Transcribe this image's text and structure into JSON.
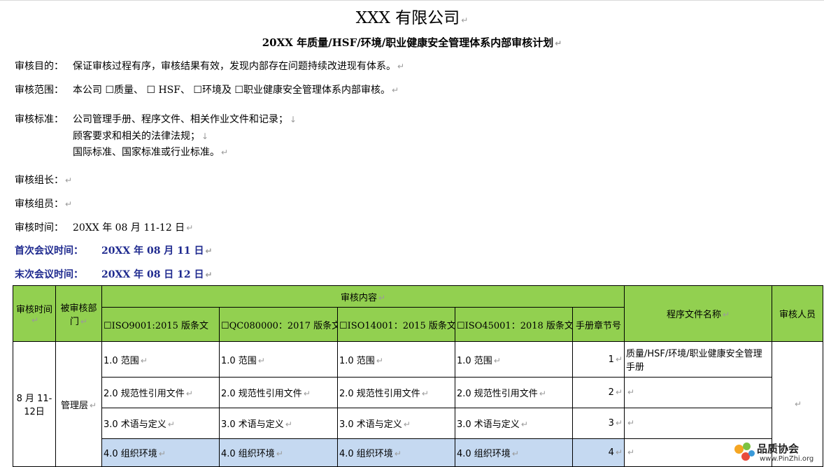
{
  "header": {
    "company": "XXX 有限公司",
    "plan_title": "20XX 年质量/HSF/环境/职业健康安全管理体系内部审核计划"
  },
  "info": {
    "purpose_label": "审核目的：",
    "purpose_value": "保证审核过程有序，审核结果有效，发现内部存在问题持续改进现有体系。",
    "scope_label": "审核范围：",
    "scope_value": "本公司 ☐质量、 ☐ HSF、 ☐环境及 ☐职业健康安全管理体系内部审核。",
    "standard_label": "审核标准：",
    "standard_lines": [
      "公司管理手册、程序文件、相关作业文件和记录；",
      "顾客要求和相关的法律法规；",
      "国际标准、国家标准或行业标准。"
    ],
    "leader_label": "审核组长：",
    "members_label": "审核组员：",
    "time_label": "审核时间：",
    "time_value": "20XX 年 08 月 11-12 日",
    "first_meeting_label": "首次会议时间：",
    "first_meeting_value": "20XX 年 08 月 11 日",
    "last_meeting_label": "末次会议时间：",
    "last_meeting_value": "20XX 年 08 日 12 日"
  },
  "table": {
    "headers": {
      "time": "审核时间",
      "dept": "被审核部门",
      "content": "审核内容",
      "iso9001": "☐ISO9001:2015 版条文",
      "qc080000": "☐QC080000：2017 版条文",
      "iso14001": "☐ISO14001：2015 版条文",
      "iso45001": "☐ISO45001：2018 版条文",
      "manual": "手册章节号",
      "procedure": "程序文件名称",
      "auditor": "审核人员"
    },
    "date": "8 月 11-12日",
    "department": "管理层",
    "rows": [
      {
        "clause": "1.0 范围",
        "chapter": "1",
        "procedure": "质量/HSF/环境/职业健康安全管理手册"
      },
      {
        "clause": "2.0 规范性引用文件",
        "chapter": "2",
        "procedure": ""
      },
      {
        "clause": "3.0 术语与定义",
        "chapter": "3",
        "procedure": ""
      },
      {
        "clause": "4.0 组织环境",
        "chapter": "4",
        "procedure": ""
      }
    ]
  },
  "watermark": {
    "name": "品质协会",
    "url": "www.PinZhi.org"
  },
  "colors": {
    "header_green": "#92d050",
    "highlight_blue": "#c5d9f1",
    "meeting_text": "#1f2a8f"
  }
}
